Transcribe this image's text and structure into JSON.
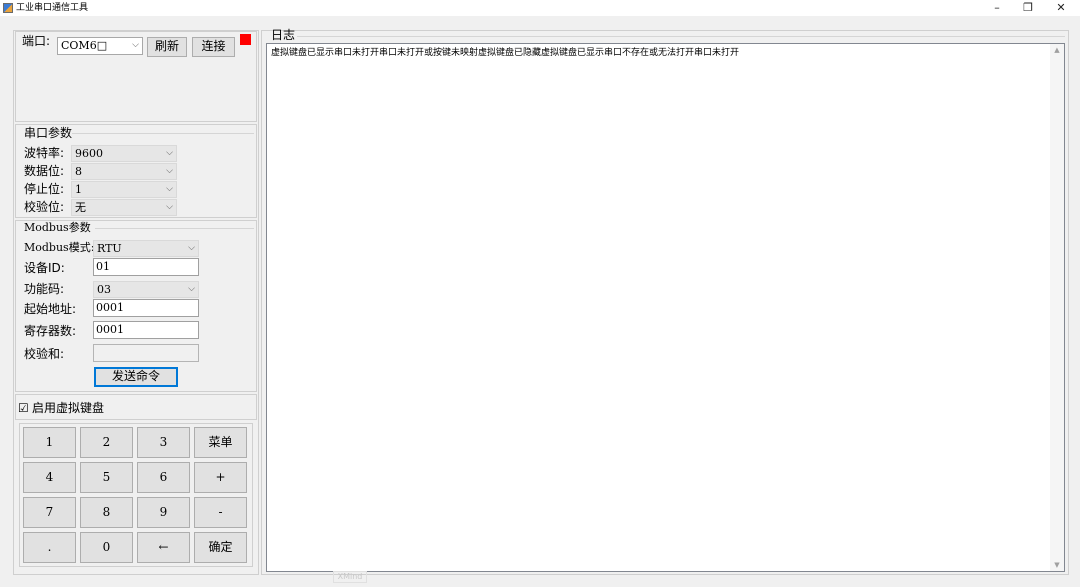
{
  "window": {
    "title": "工业串口通信工具",
    "minimize": "–",
    "restore": "❐",
    "close": "✕"
  },
  "connection": {
    "port_label": "端口:",
    "port_value": "COM6□",
    "refresh_label": "刷新",
    "connect_label": "连接",
    "status_color": "#ff0000"
  },
  "serial_params": {
    "group_title": "串口参数",
    "baud_label": "波特率:",
    "baud_value": "9600",
    "databits_label": "数据位:",
    "databits_value": "8",
    "stopbits_label": "停止位:",
    "stopbits_value": "1",
    "parity_label": "校验位:",
    "parity_value": "无"
  },
  "modbus": {
    "group_title": "Modbus参数",
    "mode_label": "Modbus模式:",
    "mode_value": "RTU",
    "device_label": "设备ID:",
    "device_value": "01",
    "func_label": "功能码:",
    "func_value": "03",
    "start_label": "起始地址:",
    "start_value": "0001",
    "count_label": "寄存器数:",
    "count_value": "0001",
    "checksum_label": "校验和:",
    "checksum_value": "",
    "send_label": "发送命令"
  },
  "keyboard": {
    "enable_label": "启用虚拟键盘",
    "enable_checked": "☑",
    "keys": [
      "1",
      "2",
      "3",
      "菜单",
      "4",
      "5",
      "6",
      "+",
      "7",
      "8",
      "9",
      "-",
      ".",
      "0",
      "←",
      "确定"
    ]
  },
  "log": {
    "title": "日志",
    "content": "虚拟键盘已显示串口未打开串口未打开或按键未映射虚拟键盘已隐藏虚拟键盘已显示串口不存在或无法打开串口未打开"
  },
  "icons": {
    "combo_arrow": "⌵",
    "scroll_up": "▲",
    "scroll_down": "▼"
  },
  "footer": {
    "watermark": "XMind"
  }
}
